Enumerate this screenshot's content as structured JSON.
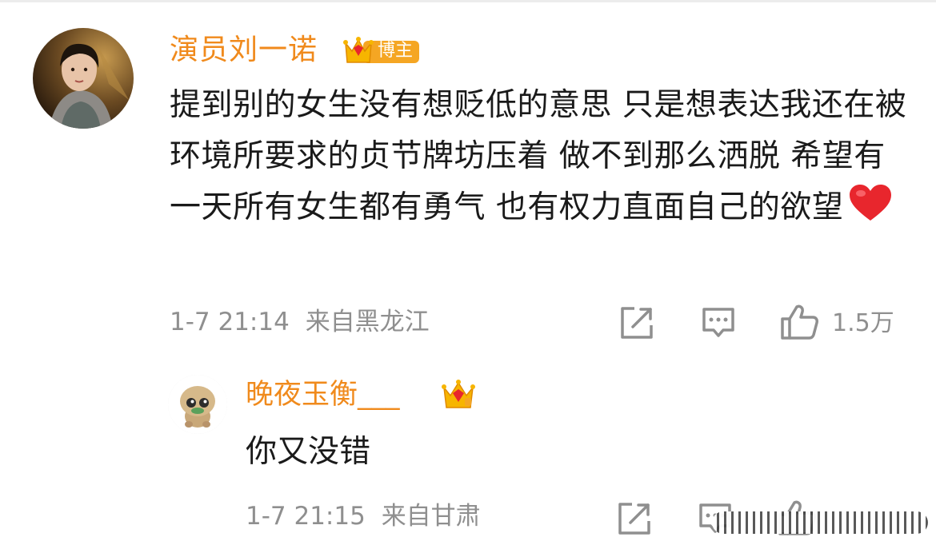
{
  "comment": {
    "author": "演员刘一诺",
    "badge_label": "博主",
    "text": "提到别的女生没有想贬低的意思 只是想表达我还在被环境所要求的贞节牌坊压着 做不到那么洒脱 希望有一天所有女生都有勇气 也有权力直面自己的欲望",
    "emoji": "❤️",
    "time": "1-7 21:14",
    "location": "来自黑龙江",
    "like_count": "1.5万"
  },
  "reply": {
    "author": "晚夜玉衡___",
    "text": "你又没错",
    "time": "1-7 21:15",
    "location": "来自甘肃"
  },
  "colors": {
    "username": "#f08a1c",
    "text": "#1a1a1a",
    "meta": "#8f8f8f",
    "badge_orange": "#f5a623",
    "heart": "#e8262d"
  },
  "icons": {
    "repost": "share-box-icon",
    "comment": "comment-bubble-icon",
    "like": "thumbs-up-icon"
  }
}
